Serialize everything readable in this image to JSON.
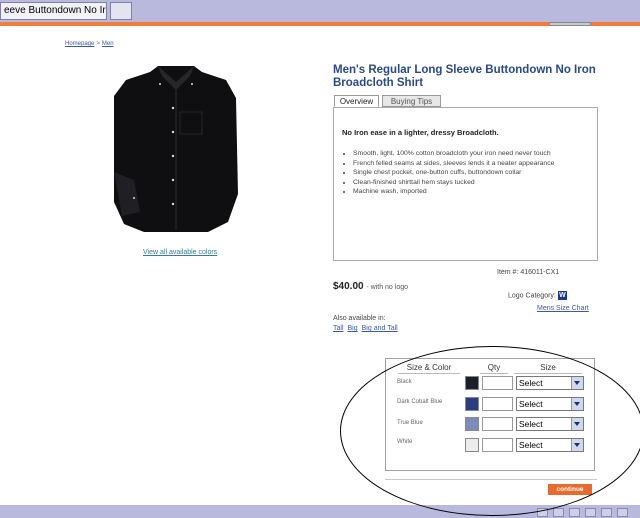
{
  "browser": {
    "tab_title": "eeve Buttondown No Ir..."
  },
  "breadcrumb": [
    "Homepage",
    "Men"
  ],
  "breadcrumb_separator": ">",
  "product": {
    "title": "Men's Regular Long Sleeve Buttondown No Iron Broadcloth Shirt",
    "tabs": [
      "Overview",
      "Buying Tips"
    ],
    "headline": "No Iron ease in a lighter, dressy Broadcloth.",
    "features": [
      "Smooth, light, 100% cotton broadcloth your iron need never touch",
      "French felled seams at sides, sleeves lends it a neater appearance",
      "Single chest pocket, one-button cuffs, buttondown collar",
      "Clean-finished shirttail hem stays tucked",
      "Machine wash, imported"
    ],
    "view_colors_link": "View all available colors",
    "item_number": "Item #: 416011-CX1",
    "price": "$40.00",
    "price_note": "- with no logo",
    "logo_category_label": "Logo Category:",
    "logo_category_badge": "W",
    "size_chart_link": "Mens Size Chart",
    "also_available_label": "Also available in:",
    "also_available_links": [
      "Tall",
      "Big",
      "Big and Tall"
    ]
  },
  "order_table": {
    "headers": {
      "size_color": "Size & Color",
      "qty": "Qty",
      "size": "Size"
    },
    "rows": [
      {
        "color": "Black",
        "swatch": "#1b1f2b",
        "qty": "",
        "size": "Select"
      },
      {
        "color": "Dark Cobalt Blue",
        "swatch": "#2a3f7f",
        "qty": "",
        "size": "Select"
      },
      {
        "color": "True Blue",
        "swatch": "#7b8dbd",
        "qty": "",
        "size": "Select"
      },
      {
        "color": "White",
        "swatch": "#ececec",
        "qty": "",
        "size": "Select"
      }
    ],
    "continue_label": "continue"
  },
  "colors": {
    "browser_bar": "#b9b9de",
    "accent_orange": "#f07d3c",
    "title_blue": "#2a4a86"
  }
}
